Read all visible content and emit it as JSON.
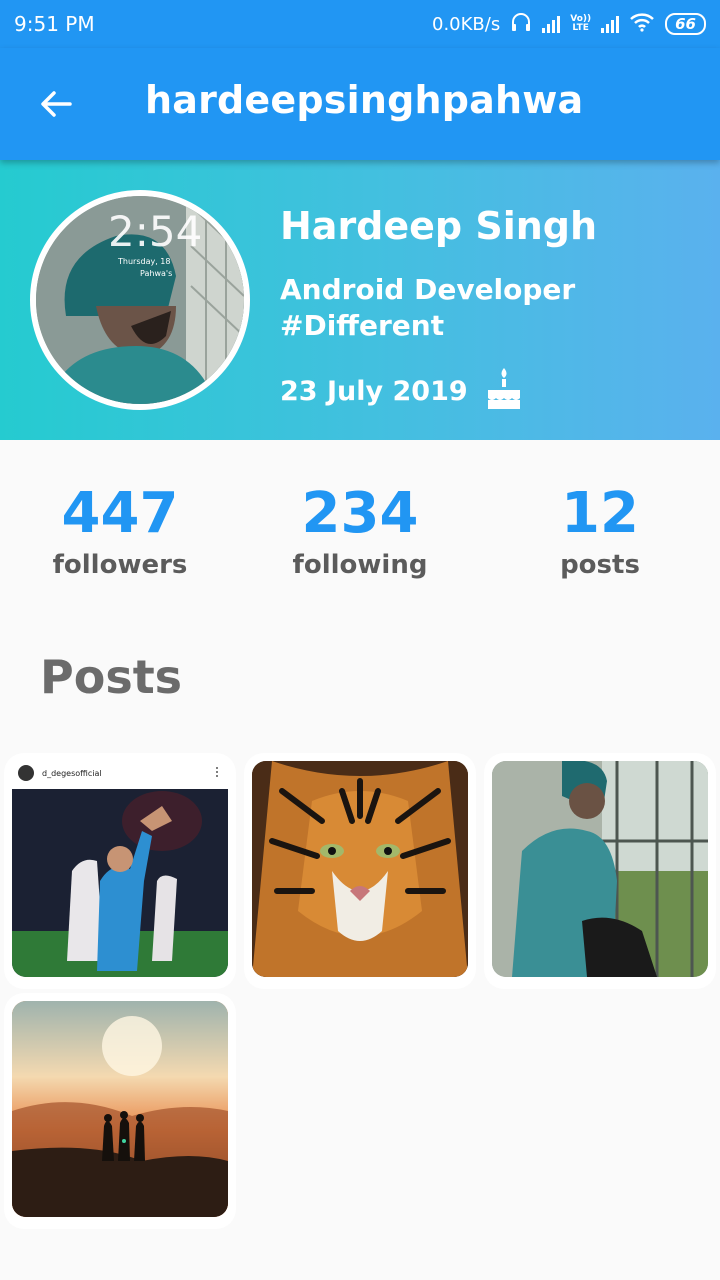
{
  "status_bar": {
    "time": "9:51 PM",
    "network_speed": "0.0KB/s",
    "lte_top": "Vo))",
    "lte_bottom": "LTE",
    "battery": "66",
    "icons": [
      "headset-icon",
      "signal-icon",
      "volte-icon",
      "signal-icon",
      "wifi-icon",
      "battery-icon"
    ]
  },
  "app_bar": {
    "title": "hardeepsinghpahwa",
    "back_icon": "arrow-back-icon"
  },
  "profile": {
    "name": "Hardeep Singh",
    "bio_line1": "Android Developer",
    "bio_line2": "#Different",
    "birthday": "23 July 2019",
    "birthday_icon": "cake-icon",
    "avatar_overlay_time": "2:54",
    "avatar_overlay_date": "Thursday, 18",
    "avatar_overlay_name": "Pahwa's"
  },
  "stats": [
    {
      "count": "447",
      "label": "followers"
    },
    {
      "count": "234",
      "label": "following"
    },
    {
      "count": "12",
      "label": "posts"
    }
  ],
  "posts_section": {
    "title": "Posts",
    "first_post_username": "d_degesofficial"
  },
  "colors": {
    "primary": "#2196f3",
    "header_gradient_start": "#25cbd0",
    "header_gradient_end": "#5ab1ee",
    "stat_label": "#5b5b5b",
    "section_title": "#6b6b6b"
  }
}
